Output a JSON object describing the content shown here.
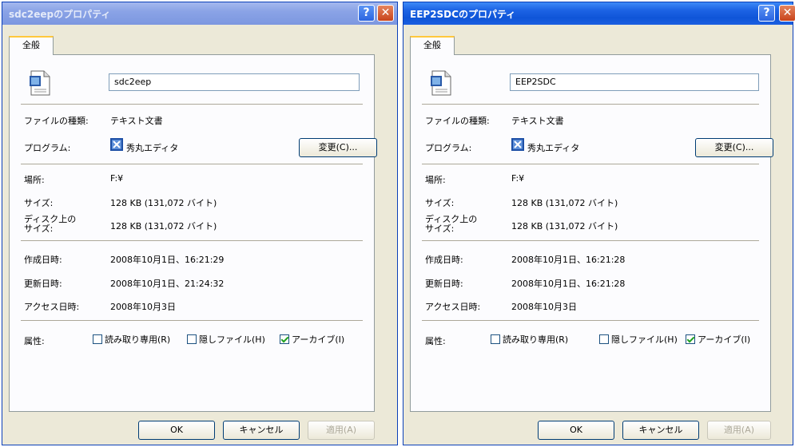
{
  "dialogs": [
    {
      "title": "sdc2eepのプロパティ",
      "help": "?",
      "close": "✕",
      "tab": "全般",
      "file_name": "sdc2eep",
      "file_type_label": "ファイルの種類:",
      "file_type_value": "テキスト文書",
      "program_label": "プログラム:",
      "program_value": "秀丸エディタ",
      "change_button": "変更(C)...",
      "location_label": "場所:",
      "location_value": "F:¥",
      "size_label": "サイズ:",
      "size_value": "128 KB (131,072 バイト)",
      "disk_size_label": "ディスク上のサイズ:",
      "disk_size_value": "128 KB (131,072 バイト)",
      "created_label": "作成日時:",
      "created_value": "2008年10月1日、16:21:29",
      "modified_label": "更新日時:",
      "modified_value": "2008年10月1日、21:24:32",
      "accessed_label": "アクセス日時:",
      "accessed_value": "2008年10月3日",
      "attributes_label": "属性:",
      "readonly_label": "読み取り専用(R)",
      "hidden_label": "隠しファイル(H)",
      "archive_label": "アーカイブ(I)",
      "readonly_checked": false,
      "hidden_checked": false,
      "archive_checked": true,
      "ok": "OK",
      "cancel": "キャンセル",
      "apply": "適用(A)",
      "active": false
    },
    {
      "title": "EEP2SDCのプロパティ",
      "help": "?",
      "close": "✕",
      "tab": "全般",
      "file_name": "EEP2SDC",
      "file_type_label": "ファイルの種類:",
      "file_type_value": "テキスト文書",
      "program_label": "プログラム:",
      "program_value": "秀丸エディタ",
      "change_button": "変更(C)...",
      "location_label": "場所:",
      "location_value": "F:¥",
      "size_label": "サイズ:",
      "size_value": "128 KB (131,072 バイト)",
      "disk_size_label": "ディスク上のサイズ:",
      "disk_size_value": "128 KB (131,072 バイト)",
      "created_label": "作成日時:",
      "created_value": "2008年10月1日、16:21:28",
      "modified_label": "更新日時:",
      "modified_value": "2008年10月1日、16:21:28",
      "accessed_label": "アクセス日時:",
      "accessed_value": "2008年10月3日",
      "attributes_label": "属性:",
      "readonly_label": "読み取り専用(R)",
      "hidden_label": "隠しファイル(H)",
      "archive_label": "アーカイブ(I)",
      "readonly_checked": false,
      "hidden_checked": false,
      "archive_checked": true,
      "ok": "OK",
      "cancel": "キャンセル",
      "apply": "適用(A)",
      "active": true
    }
  ],
  "colors": {
    "title_active": "#0f55d8",
    "title_inactive": "#8aa3e6",
    "dialog_face": "#ece9d8",
    "tab_accent": "#ffc83c"
  }
}
